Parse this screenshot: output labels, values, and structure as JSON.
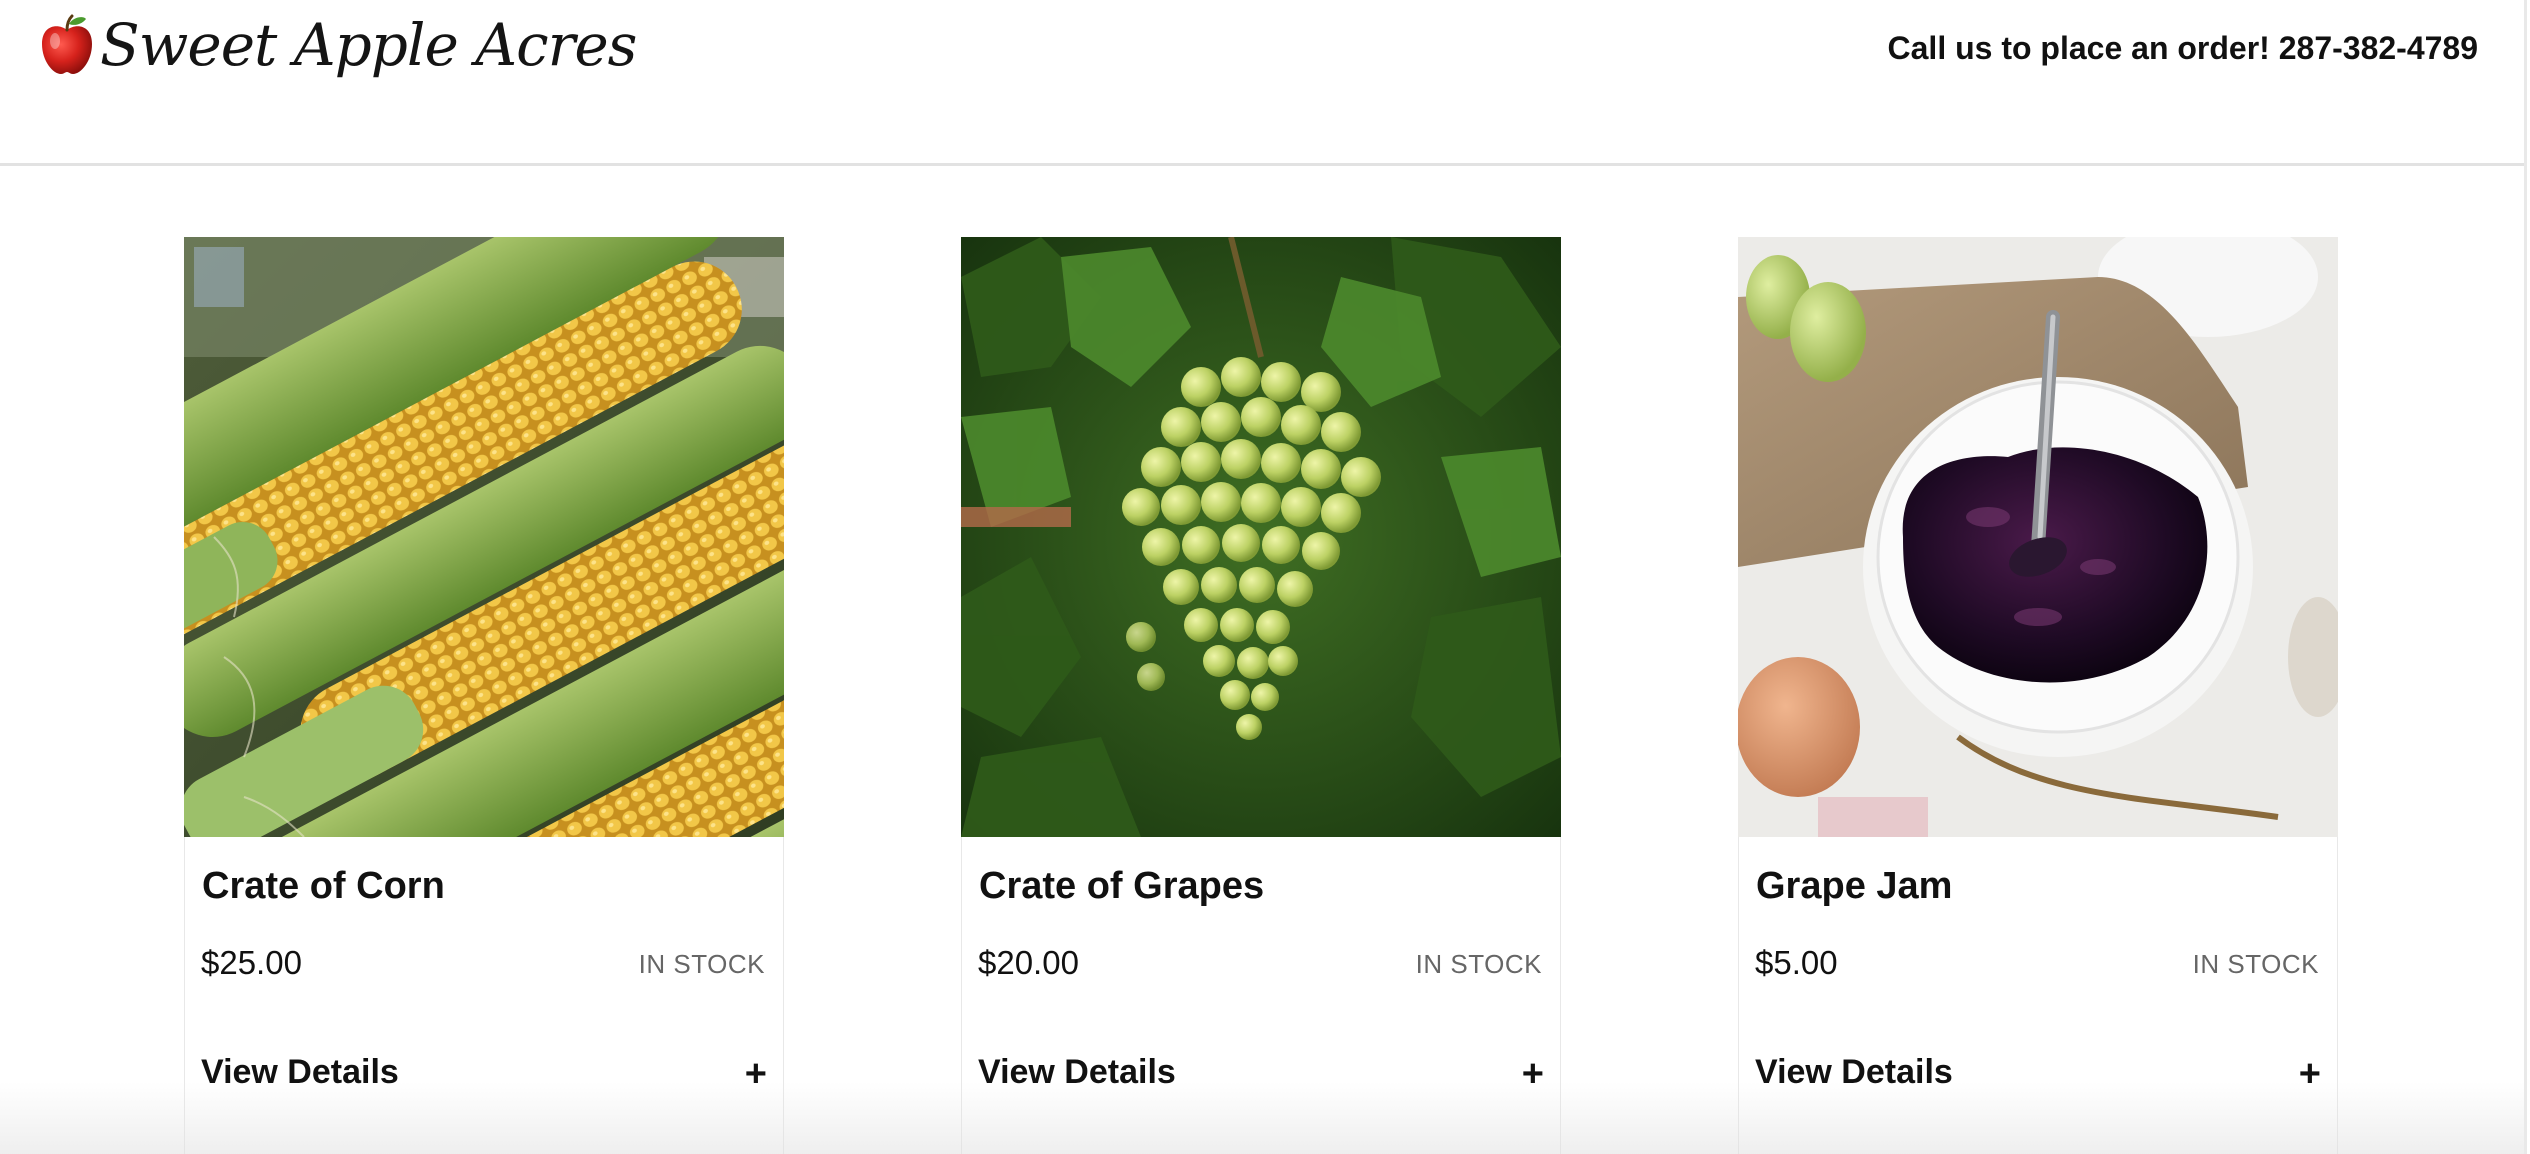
{
  "header": {
    "site_name": "Sweet Apple Acres",
    "phone_text": "Call us to place an order! 287-382-4789",
    "logo_icon": "red-apple-icon"
  },
  "products": [
    {
      "title": "Crate of Corn",
      "price": "$25.00",
      "stock": "IN STOCK",
      "details_label": "View Details",
      "toggle_symbol": "+",
      "image_icon": "corn-photo"
    },
    {
      "title": "Crate of Grapes",
      "price": "$20.00",
      "stock": "IN STOCK",
      "details_label": "View Details",
      "toggle_symbol": "+",
      "image_icon": "grapes-photo"
    },
    {
      "title": "Grape Jam",
      "price": "$5.00",
      "stock": "IN STOCK",
      "details_label": "View Details",
      "toggle_symbol": "+",
      "image_icon": "grape-jam-photo"
    }
  ],
  "colors": {
    "text": "#111111",
    "muted": "#666666",
    "divider": "#e2e2e2",
    "apple_red": "#d6221c"
  }
}
